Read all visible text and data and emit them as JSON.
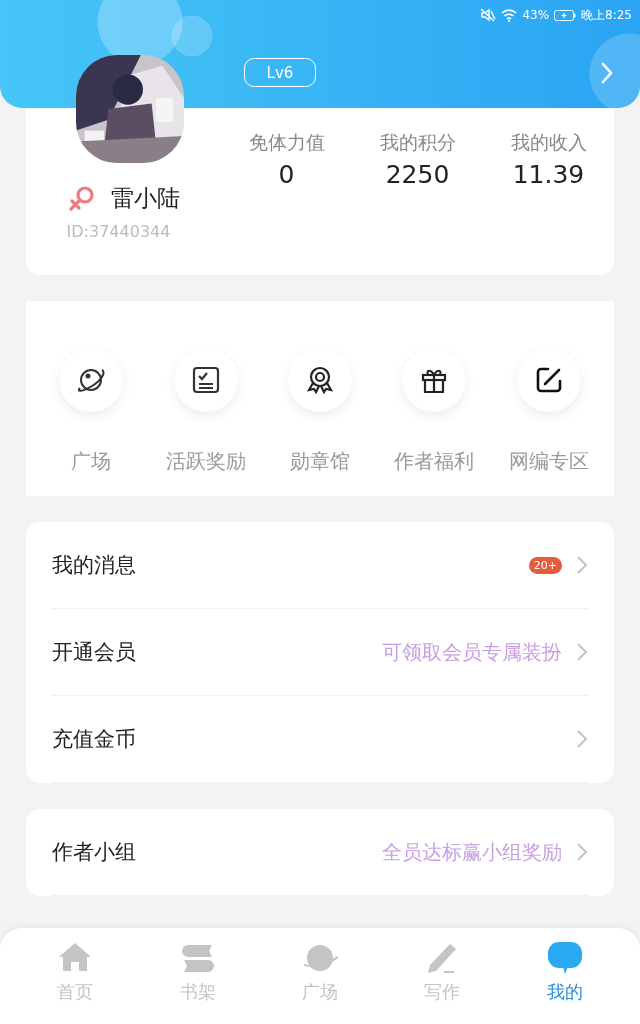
{
  "status_bar": {
    "battery": "43%",
    "time": "晚上8:25"
  },
  "profile": {
    "level": "Lv6",
    "name": "雷小陆",
    "id": "ID:37440344",
    "stats": [
      {
        "label": "免体力值",
        "value": "0"
      },
      {
        "label": "我的积分",
        "value": "2250"
      },
      {
        "label": "我的收入",
        "value": "11.39"
      }
    ]
  },
  "shortcuts": [
    {
      "label": "广场"
    },
    {
      "label": "活跃奖励"
    },
    {
      "label": "勋章馆"
    },
    {
      "label": "作者福利"
    },
    {
      "label": "网编专区"
    }
  ],
  "menu_groups": [
    [
      {
        "label": "我的消息",
        "badge": "20+"
      },
      {
        "label": "开通会员",
        "hint": "可领取会员专属装扮"
      },
      {
        "label": "充值金币"
      }
    ],
    [
      {
        "label": "作者小组",
        "hint": "全员达标赢小组奖励"
      }
    ]
  ],
  "tab_bar": [
    {
      "label": "首页",
      "selected": false
    },
    {
      "label": "书架",
      "selected": false
    },
    {
      "label": "广场",
      "selected": false
    },
    {
      "label": "写作",
      "selected": false
    },
    {
      "label": "我的",
      "selected": true
    }
  ]
}
